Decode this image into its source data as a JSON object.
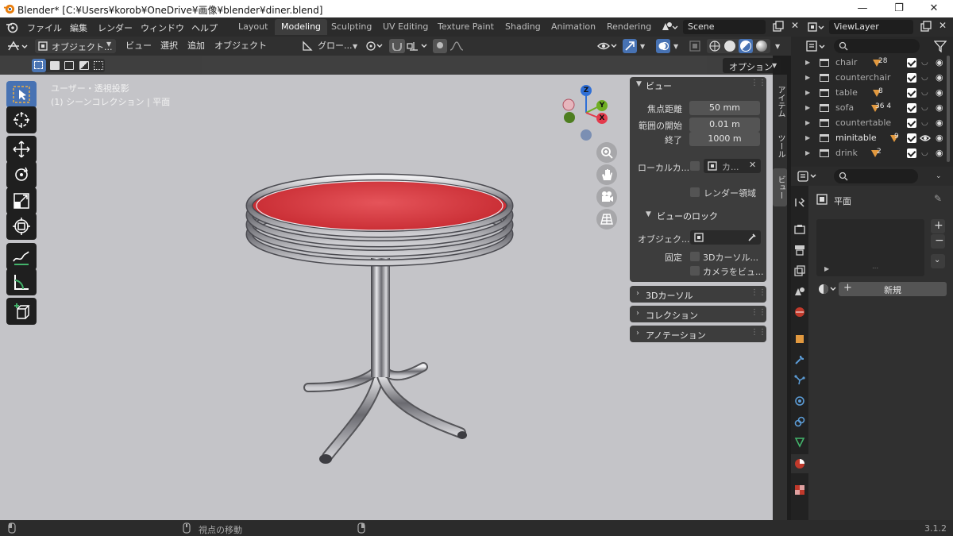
{
  "window": {
    "title": "Blender* [C:¥Users¥korob¥OneDrive¥画像¥blender¥diner.blend]",
    "controls": [
      "—",
      "❐",
      "✕"
    ]
  },
  "menu": [
    "ファイル",
    "編集",
    "レンダー",
    "ウィンドウ",
    "ヘルプ"
  ],
  "workspaces": [
    {
      "label": "Layout",
      "active": false
    },
    {
      "label": "Modeling",
      "active": true
    },
    {
      "label": "Sculpting",
      "active": false
    },
    {
      "label": "UV Editing",
      "active": false
    },
    {
      "label": "Texture Paint",
      "active": false
    },
    {
      "label": "Shading",
      "active": false
    },
    {
      "label": "Animation",
      "active": false
    },
    {
      "label": "Rendering",
      "active": false
    }
  ],
  "scene": "Scene",
  "viewlayer": "ViewLayer",
  "header3d": {
    "mode": "オブジェクト...",
    "view": "ビュー",
    "select": "選択",
    "add": "追加",
    "object": "オブジェクト",
    "transform": "グロー...",
    "options": "オプション"
  },
  "viewport": {
    "view_name": "ユーザー・透視投影",
    "collection": "(1) シーンコレクション | 平面",
    "gizmo": {
      "z": "Z",
      "y": "Y",
      "x": "X"
    },
    "colors": {
      "background": "#c4c4c8",
      "tabletop": "#d43a3f",
      "chrome": "#9a9aa0"
    }
  },
  "npanel": {
    "view_header": "ビュー",
    "focal_label": "焦点距離",
    "focal_value": "50 mm",
    "clip_start_label": "範囲の開始",
    "clip_start_value": "0.01 m",
    "clip_end_label": "終了",
    "clip_end_value": "1000 m",
    "local_camera_label": "ローカルカ...",
    "local_camera_value": "カ...",
    "render_region": "レンダー領域",
    "view_lock_header": "ビューのロック",
    "lock_object_label": "オブジェク...",
    "lock_label": "固定",
    "lock_cursor": "3Dカーソル...",
    "lock_camera": "カメラをビュ...",
    "cursor_header": "3Dカーソル",
    "collection_header": "コレクション",
    "annotation_header": "アノテーション"
  },
  "tabs": [
    "アイテム",
    "ツール",
    "ビュー"
  ],
  "outliner": [
    {
      "name": "chair",
      "badge": "28",
      "visible": false
    },
    {
      "name": "counterchair",
      "badge": "",
      "visible": false
    },
    {
      "name": "table",
      "badge": "8",
      "visible": false
    },
    {
      "name": "sofa",
      "badge": "36  4",
      "visible": false
    },
    {
      "name": "countertable",
      "badge": "",
      "visible": false
    },
    {
      "name": "minitable",
      "badge": "9",
      "visible": true
    },
    {
      "name": "drink",
      "badge": "2",
      "visible": false
    }
  ],
  "properties": {
    "object_name": "平面",
    "new_button": "新規"
  },
  "status": {
    "action": "視点の移動",
    "version": "3.1.2"
  }
}
